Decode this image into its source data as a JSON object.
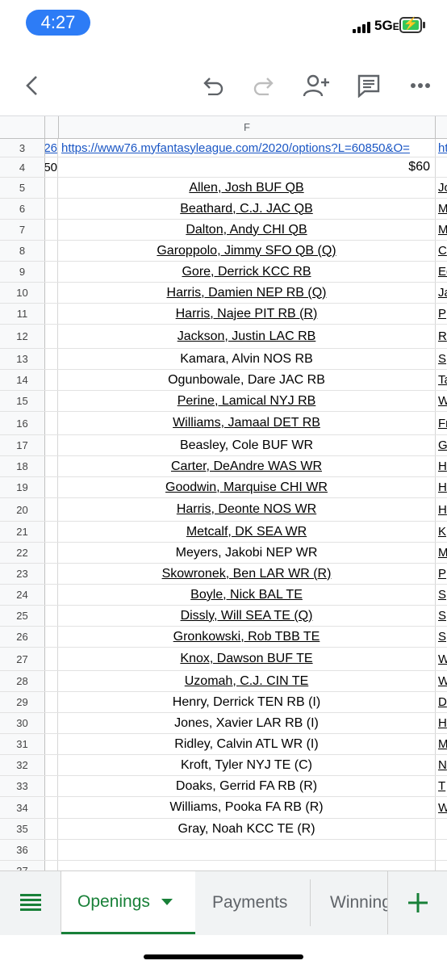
{
  "status_bar": {
    "time": "4:27",
    "network": "5G",
    "network_suffix": "E",
    "bolt": "⚡"
  },
  "toolbar": {
    "back": "back-arrow-icon",
    "undo": "undo-icon",
    "redo": "redo-icon",
    "share": "add-person-icon",
    "comment": "comment-icon",
    "more": "more-horizontal-icon"
  },
  "sheet": {
    "column_letter": "F",
    "rows": [
      {
        "num": "3",
        "e": "26",
        "f": "https://www76.myfantasyleague.com/2020/options?L=60850&O=",
        "g": "ht",
        "kind": "link"
      },
      {
        "num": "4",
        "e": "50",
        "f": "$60",
        "g": "",
        "kind": "value"
      },
      {
        "num": "5",
        "f": "Allen, Josh BUF QB",
        "g": "Jo",
        "u": true
      },
      {
        "num": "6",
        "f": "Beathard, C.J. JAC QB",
        "g": "M",
        "u": true
      },
      {
        "num": "7",
        "f": "Dalton, Andy CHI QB",
        "g": "M",
        "u": true
      },
      {
        "num": "8",
        "f": "Garoppolo, Jimmy SFO QB (Q)",
        "g": "C",
        "u": true
      },
      {
        "num": "9",
        "f": "Gore, Derrick KCC RB",
        "g": "Ed",
        "u": true
      },
      {
        "num": "10",
        "f": "Harris, Damien NEP RB (Q)",
        "g": "Ja",
        "u": true
      },
      {
        "num": "11",
        "f": "Harris, Najee PIT RB (R)",
        "g": "P",
        "u": true
      },
      {
        "num": "12",
        "f": "Jackson, Justin LAC RB",
        "g": "R",
        "u": true
      },
      {
        "num": "13",
        "f": "Kamara, Alvin NOS RB",
        "g": "S",
        "u": false
      },
      {
        "num": "14",
        "f": "Ogunbowale, Dare JAC RB",
        "g": "Ta",
        "u": false
      },
      {
        "num": "15",
        "f": "Perine, Lamical NYJ RB",
        "g": "W",
        "u": true
      },
      {
        "num": "16",
        "f": "Williams, Jamaal DET RB",
        "g": "Fr",
        "u": true
      },
      {
        "num": "17",
        "f": "Beasley, Cole BUF WR",
        "g": "G",
        "u": false
      },
      {
        "num": "18",
        "f": "Carter, DeAndre WAS WR",
        "g": "H",
        "u": true
      },
      {
        "num": "19",
        "f": "Goodwin, Marquise CHI WR",
        "g": "H",
        "u": true
      },
      {
        "num": "20",
        "f": "Harris, Deonte NOS WR",
        "g": "H",
        "u": true
      },
      {
        "num": "21",
        "f": "Metcalf, DK SEA WR",
        "g": "K",
        "u": true
      },
      {
        "num": "22",
        "f": "Meyers, Jakobi NEP WR",
        "g": "M",
        "u": false
      },
      {
        "num": "23",
        "f": "Skowronek, Ben LAR WR (R)",
        "g": "P",
        "u": true
      },
      {
        "num": "24",
        "f": "Boyle, Nick BAL TE",
        "g": "S",
        "u": true
      },
      {
        "num": "25",
        "f": "Dissly, Will SEA TE (Q)",
        "g": "S",
        "u": true
      },
      {
        "num": "26",
        "f": "Gronkowski, Rob TBB TE",
        "g": "S",
        "u": true
      },
      {
        "num": "27",
        "f": "Knox, Dawson BUF TE",
        "g": "W",
        "u": true
      },
      {
        "num": "28",
        "f": "Uzomah, C.J. CIN TE",
        "g": "W",
        "u": true
      },
      {
        "num": "29",
        "f": "Henry, Derrick TEN RB (I)",
        "g": "D",
        "u": false
      },
      {
        "num": "30",
        "f": "Jones, Xavier LAR RB (I)",
        "g": "H",
        "u": false
      },
      {
        "num": "31",
        "f": "Ridley, Calvin ATL WR (I)",
        "g": "M",
        "u": false
      },
      {
        "num": "32",
        "f": "Kroft, Tyler NYJ TE (C)",
        "g": "N",
        "u": false
      },
      {
        "num": "33",
        "f": "Doaks, Gerrid FA RB (R)",
        "g": "T",
        "u": false
      },
      {
        "num": "34",
        "f": "Williams, Pooka FA RB (R)",
        "g": "W",
        "u": false
      },
      {
        "num": "35",
        "f": "Gray, Noah KCC TE (R)",
        "g": "",
        "u": false
      },
      {
        "num": "36",
        "f": "",
        "g": "",
        "u": false
      },
      {
        "num": "37",
        "f": "",
        "g": "",
        "u": false
      }
    ]
  },
  "tabs": {
    "active": "Openings",
    "items": [
      "Payments",
      "Winnings"
    ],
    "menu_icon": "sheets-list-icon",
    "add_icon": "plus-icon",
    "dropdown_icon": "dropdown-triangle-icon",
    "accent": "#188038"
  }
}
